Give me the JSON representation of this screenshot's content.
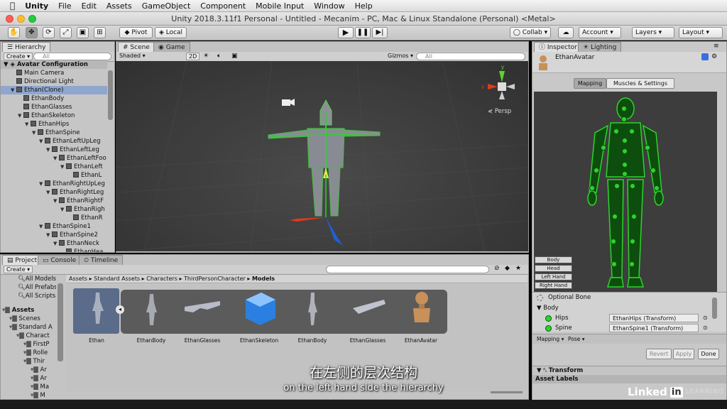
{
  "menubar": {
    "apple": "",
    "app": "Unity",
    "items": [
      "File",
      "Edit",
      "Assets",
      "GameObject",
      "Component",
      "Mobile Input",
      "Window",
      "Help"
    ]
  },
  "window": {
    "title": "Unity 2018.3.11f1 Personal - Untitled - Mecanim - PC, Mac & Linux Standalone (Personal) <Metal>"
  },
  "toolbar": {
    "pivot": "Pivot",
    "local": "Local",
    "collab": "Collab",
    "account": "Account",
    "layers": "Layers",
    "layout": "Layout"
  },
  "hierarchy": {
    "tab": "Hierarchy",
    "create": "Create",
    "search": "All",
    "root": "Avatar Configuration",
    "rows": [
      {
        "indent": 1,
        "label": "Main Camera"
      },
      {
        "indent": 1,
        "label": "Directional Light"
      },
      {
        "indent": 1,
        "label": "Ethan(Clone)",
        "selected": true,
        "arrow": "▼"
      },
      {
        "indent": 2,
        "label": "EthanBody"
      },
      {
        "indent": 2,
        "label": "EthanGlasses"
      },
      {
        "indent": 2,
        "label": "EthanSkeleton",
        "arrow": "▼"
      },
      {
        "indent": 3,
        "label": "EthanHips",
        "arrow": "▼"
      },
      {
        "indent": 4,
        "label": "EthanSpine",
        "arrow": "▼"
      },
      {
        "indent": 5,
        "label": "EthanLeftUpLeg",
        "arrow": "▼"
      },
      {
        "indent": 6,
        "label": "EthanLeftLeg",
        "arrow": "▼"
      },
      {
        "indent": 7,
        "label": "EthanLeftFoo",
        "arrow": "▼"
      },
      {
        "indent": 8,
        "label": "EthanLeft",
        "arrow": "▼"
      },
      {
        "indent": 9,
        "label": "EthanL"
      },
      {
        "indent": 5,
        "label": "EthanRightUpLeg",
        "arrow": "▼"
      },
      {
        "indent": 6,
        "label": "EthanRightLeg",
        "arrow": "▼"
      },
      {
        "indent": 7,
        "label": "EthanRightF",
        "arrow": "▼"
      },
      {
        "indent": 8,
        "label": "EthanRigh",
        "arrow": "▼"
      },
      {
        "indent": 9,
        "label": "EthanR"
      },
      {
        "indent": 5,
        "label": "EthanSpine1",
        "arrow": "▼"
      },
      {
        "indent": 6,
        "label": "EthanSpine2",
        "arrow": "▼"
      },
      {
        "indent": 7,
        "label": "EthanNeck",
        "arrow": "▼"
      },
      {
        "indent": 8,
        "label": "EthanHea"
      }
    ]
  },
  "scene": {
    "tab_scene": "Scene",
    "tab_game": "Game",
    "shaded": "Shaded",
    "mode2d": "2D",
    "gizmos": "Gizmos",
    "search": "All",
    "persp": "Persp"
  },
  "project": {
    "tab_project": "Project",
    "tab_console": "Console",
    "tab_timeline": "Timeline",
    "create": "Create",
    "favorites": [
      "All Models",
      "All Prefabs",
      "All Scripts"
    ],
    "tree": [
      {
        "indent": 0,
        "label": "Assets"
      },
      {
        "indent": 1,
        "label": "Scenes"
      },
      {
        "indent": 1,
        "label": "Standard A"
      },
      {
        "indent": 2,
        "label": "Charact"
      },
      {
        "indent": 3,
        "label": "FirstP"
      },
      {
        "indent": 3,
        "label": "Rolle"
      },
      {
        "indent": 3,
        "label": "Thir"
      },
      {
        "indent": 4,
        "label": "Ar"
      },
      {
        "indent": 4,
        "label": "Ar"
      },
      {
        "indent": 4,
        "label": "Ma"
      },
      {
        "indent": 4,
        "label": "M"
      }
    ],
    "breadcrumb": [
      "Assets",
      "Standard Assets",
      "Characters",
      "ThirdPersonCharacter",
      "Models"
    ],
    "items": [
      "Ethan",
      "EthanBody",
      "EthanGlasses",
      "EthanSkeleton",
      "EthanBody",
      "EthanGlasses",
      "EthanAvatar"
    ]
  },
  "inspector": {
    "tab_inspector": "Inspector",
    "tab_lighting": "Lighting",
    "object": "EthanAvatar",
    "mapping": "Mapping",
    "muscles": "Muscles & Settings",
    "body_tabs": [
      "Body",
      "Head",
      "Left Hand",
      "Right Hand"
    ],
    "optional_bone": "Optional Bone",
    "section": "Body",
    "bones": [
      {
        "label": "Hips",
        "value": "EthanHips (Transform)"
      },
      {
        "label": "Spine",
        "value": "EthanSpine1 (Transform)"
      }
    ],
    "mapping_dd": "Mapping",
    "pose_dd": "Pose",
    "revert": "Revert",
    "apply": "Apply",
    "done": "Done",
    "transform": "Transform",
    "asset_labels": "Asset Labels"
  },
  "overlay": {
    "subtitle_cn": "在左侧的层次结构",
    "subtitle_en": "on the left hand side the hierarchy",
    "brand": "Linked",
    "brand_in": "in",
    "brand_learning": "LEARNING"
  }
}
